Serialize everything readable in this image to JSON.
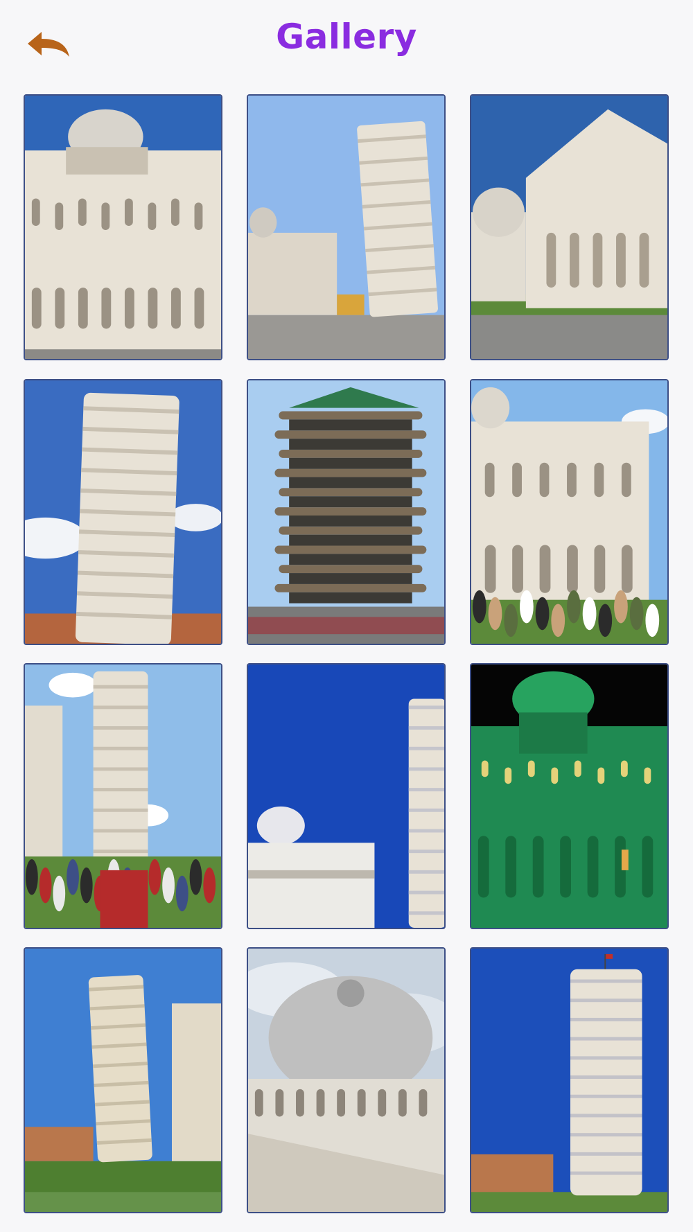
{
  "header": {
    "title": "Gallery",
    "back_icon": "back-arrow-icon"
  },
  "colors": {
    "title": "#8a2ce0",
    "back_arrow": "#b8641a",
    "tile_border": "#3d4f86",
    "background": "#f7f7f9"
  },
  "gallery": {
    "photos": [
      {
        "subject": "cathedral-dome",
        "sky": "#2f66b8"
      },
      {
        "subject": "leaning-tower-plaza",
        "sky": "#8fb8ec"
      },
      {
        "subject": "cathedral-facade-baptistery",
        "sky": "#2e63ad"
      },
      {
        "subject": "leaning-tower-low-angle",
        "sky": "#3a6cc1"
      },
      {
        "subject": "leaning-tower-replica",
        "sky": "#a9cdf0"
      },
      {
        "subject": "cathedral-with-crowd",
        "sky": "#84b7ea"
      },
      {
        "subject": "tower-and-tourists",
        "sky": "#8fbde9"
      },
      {
        "subject": "tower-and-dome-blue-sky",
        "sky": "#1848b8"
      },
      {
        "subject": "cathedral-night-green",
        "sky": "#050505"
      },
      {
        "subject": "tower-and-cathedral-lawn",
        "sky": "#3f7fd2"
      },
      {
        "subject": "dome-cloudy-sky",
        "sky": "#c8d3df"
      },
      {
        "subject": "tower-deep-blue-sky",
        "sky": "#1c4fba"
      }
    ]
  }
}
